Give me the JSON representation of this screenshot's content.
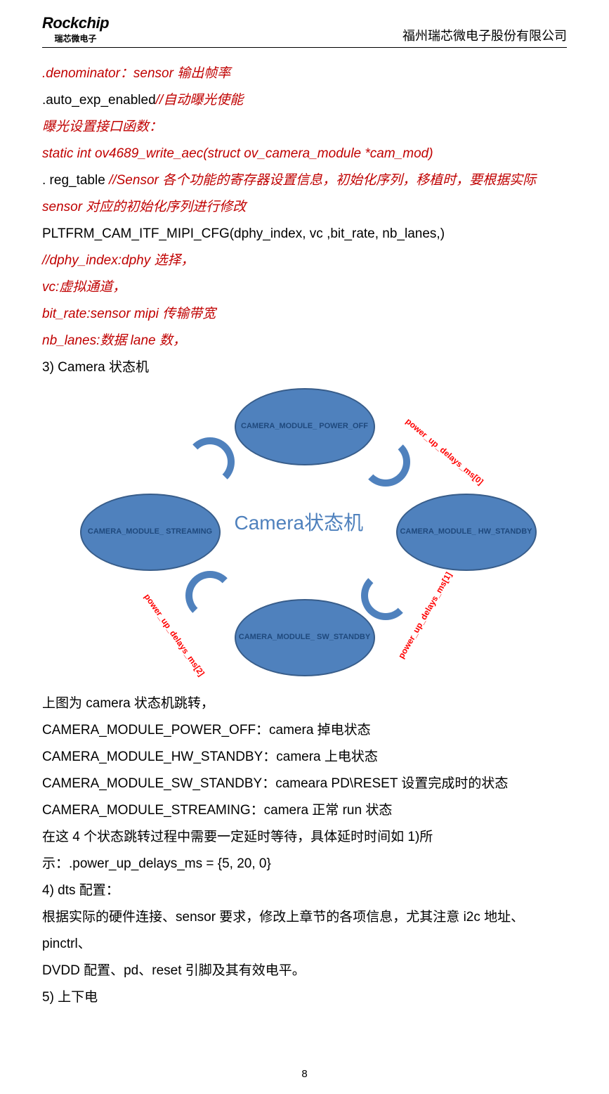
{
  "header": {
    "logo_main": "Rockchip",
    "logo_sub": "瑞芯微电子",
    "company": "福州瑞芯微电子股份有限公司"
  },
  "lines": {
    "l1": ".denominator：sensor 输出帧率",
    "l2a": ".auto_exp_enabled",
    "l2b": "//自动曝光使能",
    "l3": "曝光设置接口函数：",
    "l4": "static int ov4689_write_aec(struct ov_camera_module *cam_mod)",
    "l5a": ". reg_table ",
    "l5b": "//Sensor 各个功能的寄存器设置信息，初始化序列，移植时，要根据实际",
    "l6": "sensor 对应的初始化序列进行修改",
    "l7": "PLTFRM_CAM_ITF_MIPI_CFG(dphy_index, vc ,bit_rate, nb_lanes,)",
    "l8": "//dphy_index:dphy 选择，",
    "l9": "vc:虚拟通道，",
    "l10": "bit_rate:sensor mipi 传输带宽",
    "l11": "nb_lanes:数据 lane 数，",
    "l12": "3)   Camera 状态机",
    "l13": "上图为 camera 状态机跳转，",
    "l14": "CAMERA_MODULE_POWER_OFF：camera 掉电状态",
    "l15": "CAMERA_MODULE_HW_STANDBY：camera 上电状态",
    "l16": "CAMERA_MODULE_SW_STANDBY：cameara PD\\RESET 设置完成时的状态",
    "l17": "CAMERA_MODULE_STREAMING：camera 正常 run 状态",
    "l18": "在这 4 个状态跳转过程中需要一定延时等待，具体延时时间如 1)所",
    "l19": "示：.power_up_delays_ms = {5, 20, 0}",
    "l20": "4)   dts 配置：",
    "l21": "根据实际的硬件连接、sensor 要求，修改上章节的各项信息，尤其注意 i2c 地址、pinctrl、",
    "l22": "DVDD 配置、pd、reset 引脚及其有效电平。",
    "l23": "5)   上下电"
  },
  "diagram": {
    "center": "Camera状态机",
    "top": "CAMERA_MODULE_\nPOWER_OFF",
    "right": "CAMERA_MODULE_\nHW_STANDBY",
    "bottom": "CAMERA_MODULE_\nSW_STANDBY",
    "left": "CAMERA_MODULE_\nSTREAMING",
    "label_tr": "power_up_delays_ms[0]",
    "label_br": "power_up_delays_ms[1]",
    "label_bl": "power_up_delays_ms[2]"
  },
  "page": "8",
  "chart_data": {
    "type": "diagram",
    "title": "Camera状态机",
    "states": [
      "CAMERA_MODULE_POWER_OFF",
      "CAMERA_MODULE_HW_STANDBY",
      "CAMERA_MODULE_SW_STANDBY",
      "CAMERA_MODULE_STREAMING"
    ],
    "transitions": [
      {
        "from": "CAMERA_MODULE_POWER_OFF",
        "to": "CAMERA_MODULE_HW_STANDBY",
        "label": "power_up_delays_ms[0]"
      },
      {
        "from": "CAMERA_MODULE_HW_STANDBY",
        "to": "CAMERA_MODULE_SW_STANDBY",
        "label": "power_up_delays_ms[1]"
      },
      {
        "from": "CAMERA_MODULE_SW_STANDBY",
        "to": "CAMERA_MODULE_STREAMING",
        "label": "power_up_delays_ms[2]"
      },
      {
        "from": "CAMERA_MODULE_STREAMING",
        "to": "CAMERA_MODULE_POWER_OFF",
        "label": ""
      }
    ],
    "power_up_delays_ms": [
      5,
      20,
      0
    ]
  }
}
